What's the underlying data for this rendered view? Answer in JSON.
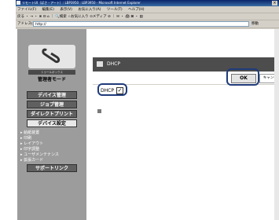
{
  "window": {
    "title": "リモートUI（ぱさ・アート）: LBP3950 : LBP3950 - Microsoft Internet Explorer"
  },
  "menu": [
    "ファイル(F)",
    "編集(E)",
    "表示(V)",
    "お気に入り(A)",
    "ツール(T)",
    "ヘルプ(H)"
  ],
  "toolbar": {
    "text": "戻る ・ → ・ ⊗ ⊡ ⌂ ｜ 🔍検索 ☆お気に入り ⊙メディア ⊘ ｜ ✉ ・ 🖨 ⊠ ・ ▤"
  },
  "address": {
    "label": "アドレス(D)",
    "value": "http://",
    "go": "移動"
  },
  "sidebar": {
    "toolbox_label": "トゥールボックス",
    "mode": "管理者モード",
    "device_manage": "デバイス管理",
    "job_manage": "ジョブ管理",
    "direct_print": "ダイレクトプリント",
    "device_settings": "デバイス設定",
    "subitems": [
      "給紙装置",
      "印刷",
      "レイアウト",
      "印字調整",
      "ユーザメンテナンス",
      "拡張カード"
    ],
    "support_link": "サポートリンク"
  },
  "panel": {
    "title": "DHCP",
    "ok": "OK",
    "cancel": "キャンセル",
    "dhcp_label": "DHCP",
    "dhcp_checked": "✓"
  }
}
